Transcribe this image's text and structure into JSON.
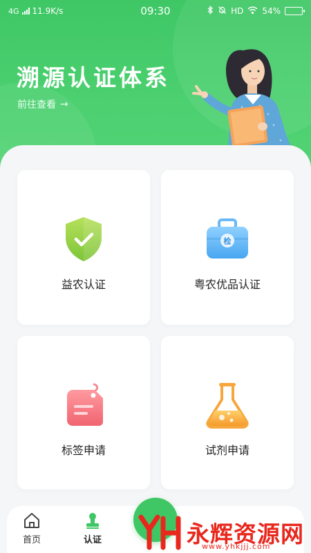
{
  "status_bar": {
    "network": "4G",
    "speed": "11.9K/s",
    "time": "09:30",
    "hd": "HD",
    "battery": "54%",
    "battery_level": 0.54
  },
  "hero": {
    "title": "溯源认证体系",
    "link_label": "前往查看",
    "link_arrow": "→"
  },
  "cards": [
    {
      "label": "益农认证",
      "icon": "shield-check-icon",
      "color": "#8ccf3a"
    },
    {
      "label": "粤农优品认证",
      "icon": "briefcase-inspection-icon",
      "color": "#4aa9f2"
    },
    {
      "label": "标签申请",
      "icon": "tag-icon",
      "color": "#f06d77"
    },
    {
      "label": "试剂申请",
      "icon": "flask-icon",
      "color": "#f7a83c"
    }
  ],
  "bottom_nav": {
    "home": "首页",
    "cert": "认证",
    "item3": "",
    "item4": ""
  },
  "watermark": {
    "text": "永辉资源网",
    "url": "www.yhkjjj.com"
  },
  "colors": {
    "brand_green": "#3fc765",
    "background": "#f5f6f7"
  }
}
